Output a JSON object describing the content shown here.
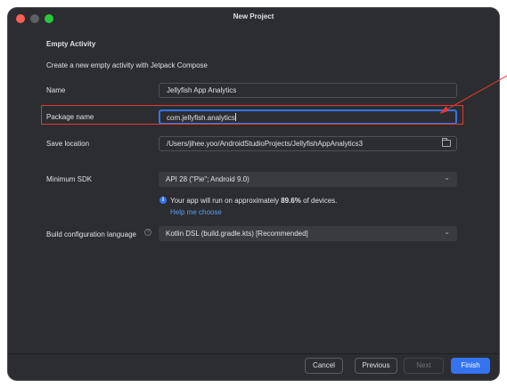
{
  "window": {
    "title": "New Project"
  },
  "page": {
    "section_title": "Empty Activity",
    "description": "Create a new empty activity with Jetpack Compose"
  },
  "form": {
    "name": {
      "label": "Name",
      "value": "Jellyfish App Analytics"
    },
    "package_name": {
      "label": "Package name",
      "value": "com.jellyfish.analytics"
    },
    "save_location": {
      "label": "Save location",
      "value": "/Users/jihee.yoo/AndroidStudioProjects/JellyfishAppAnalytics3",
      "icon": "folder-icon"
    },
    "minimum_sdk": {
      "label": "Minimum SDK",
      "value": "API 28 (\"Pie\"; Android 9.0)"
    },
    "sdk_info": {
      "prefix": "Your app will run on approximately ",
      "percent": "89.6%",
      "suffix": " of devices.",
      "link": "Help me choose"
    },
    "build_language": {
      "label": "Build configuration language",
      "value": "Kotlin DSL (build.gradle.kts) [Recommended]"
    }
  },
  "footer": {
    "cancel": "Cancel",
    "previous": "Previous",
    "next": "Next",
    "finish": "Finish"
  },
  "colors": {
    "background": "#2b2d30",
    "accent": "#3574f0",
    "link": "#589df6",
    "annotation": "#e53935"
  }
}
